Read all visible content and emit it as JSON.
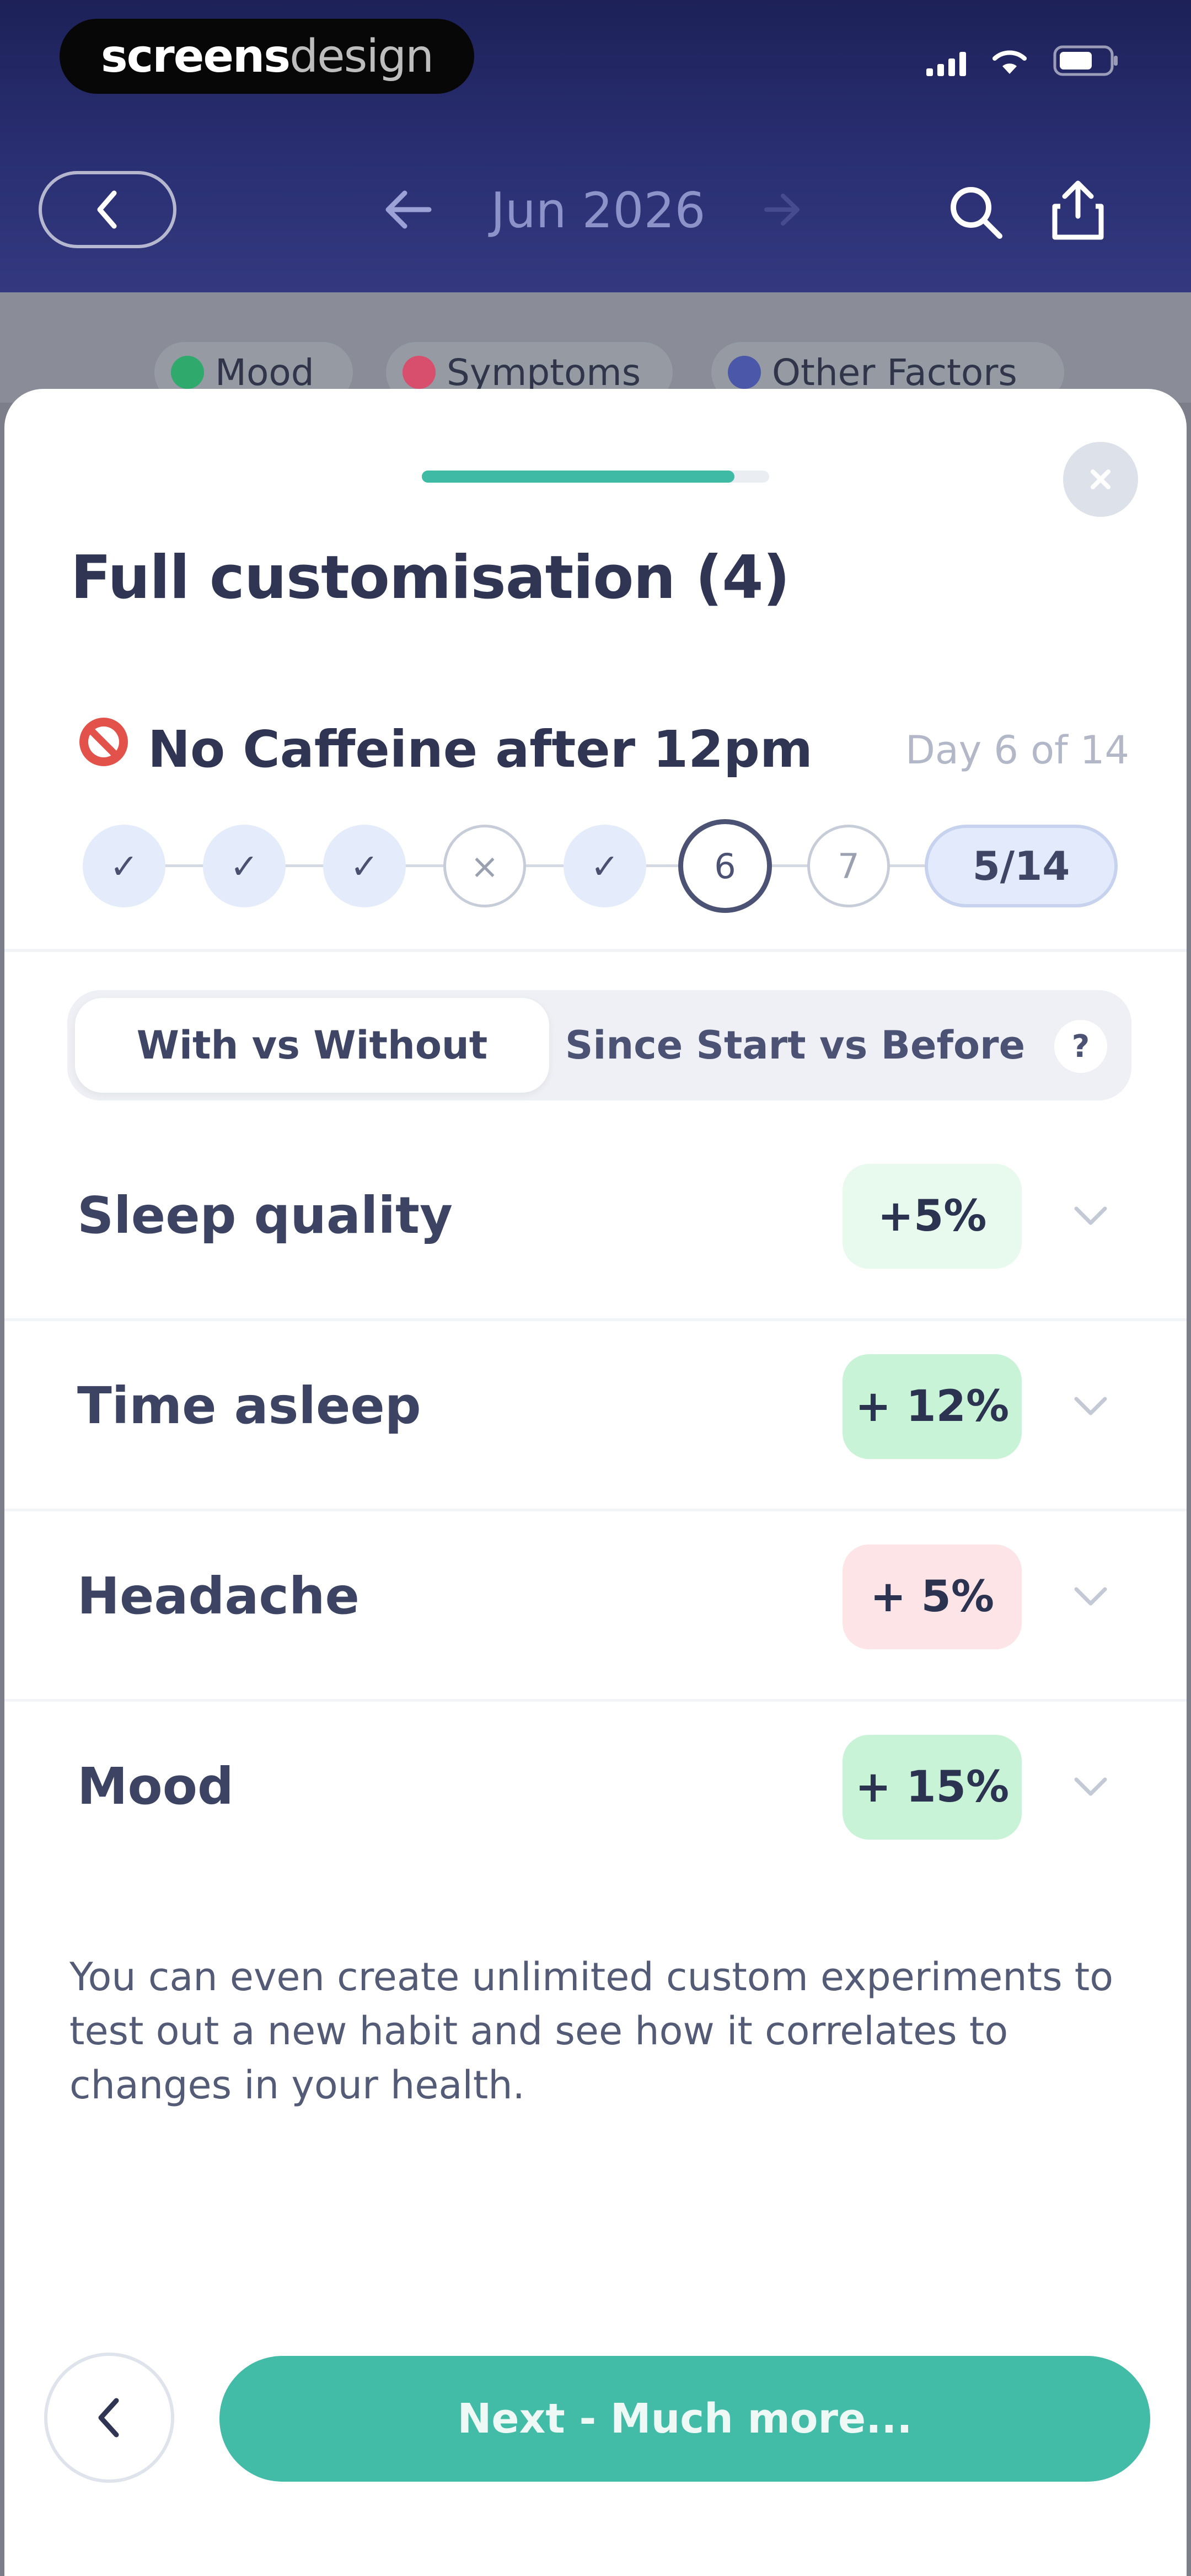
{
  "status_bar": {
    "brand_part1": "screens",
    "brand_part2": "design"
  },
  "nav": {
    "month": "Jun 2026"
  },
  "filters": [
    {
      "label": "Mood",
      "color": "#2faa6c"
    },
    {
      "label": "Symptoms",
      "color": "#d84f6d"
    },
    {
      "label": "Other Factors",
      "color": "#4b57a8"
    }
  ],
  "sheet": {
    "progress_fraction": 0.9,
    "title": "Full customisation (4)",
    "experiment": {
      "name": "No Caffeine after 12pm",
      "day_label": "Day 6 of 14",
      "days": [
        {
          "state": "done",
          "glyph": "✓"
        },
        {
          "state": "done",
          "glyph": "✓"
        },
        {
          "state": "done",
          "glyph": "✓"
        },
        {
          "state": "missed",
          "glyph": "×"
        },
        {
          "state": "done",
          "glyph": "✓"
        },
        {
          "state": "current",
          "glyph": "6"
        },
        {
          "state": "future",
          "glyph": "7"
        }
      ],
      "total": "5/14"
    },
    "tabs": {
      "active": "With vs Without",
      "inactive": "Since Start vs Before",
      "help": "?"
    },
    "metrics": [
      {
        "label": "Sleep quality",
        "value": "+5%",
        "tone": "green-light"
      },
      {
        "label": "Time asleep",
        "value": "+ 12%",
        "tone": "green"
      },
      {
        "label": "Headache",
        "value": "+ 5%",
        "tone": "red"
      },
      {
        "label": "Mood",
        "value": "+ 15%",
        "tone": "green"
      }
    ],
    "info": "You can even create unlimited custom experiments to test out a new habit and see how it correlates to changes in your health.",
    "next_label": "Next - Much more..."
  }
}
